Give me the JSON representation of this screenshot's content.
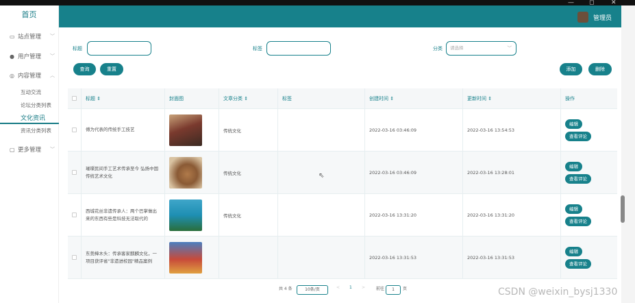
{
  "window": {
    "min": "—",
    "max": "◻",
    "close": "✕"
  },
  "sidebar": {
    "home": "首页",
    "items": [
      {
        "label": "站点管理",
        "icon": "monitor-icon"
      },
      {
        "label": "用户管理",
        "icon": "user-icon"
      },
      {
        "label": "内容管理",
        "icon": "content-icon"
      },
      {
        "label": "更多管理",
        "icon": "more-icon"
      }
    ],
    "subitems": [
      "互动交流",
      "论坛分类列表",
      "文化资讯",
      "资讯分类列表"
    ]
  },
  "header": {
    "admin": "管理员"
  },
  "search": {
    "title_label": "标题",
    "tag_label": "标签",
    "category_label": "分类",
    "category_placeholder": "请选择",
    "query_button": "查询",
    "reset_button": "重置",
    "add_button": "添加",
    "delete_button": "删除"
  },
  "table": {
    "columns": [
      "标题 ⇕",
      "封面图",
      "文章分类 ⇕",
      "标签",
      "创建时间 ⇕",
      "更新时间 ⇕",
      "操作"
    ],
    "rows": [
      {
        "title": "傅为代表的传统手工技艺",
        "category": "传统文化",
        "tag": "",
        "created": "2022-03-16 03:46:09",
        "updated": "2022-03-16 13:54:53"
      },
      {
        "title": "璀璨民间手工艺术传承至今 弘扬中国传统艺术文化",
        "category": "传统文化",
        "tag": "",
        "created": "2022-03-16 03:46:09",
        "updated": "2022-03-16 13:28:01"
      },
      {
        "title": "西城花丝非遗传承人：两个巴掌做出来的东西有些是科技无法取代的",
        "category": "传统文化",
        "tag": "",
        "created": "2022-03-16 13:31:20",
        "updated": "2022-03-16 13:31:20"
      },
      {
        "title": "东莞樟木头：传承客家麒麟文化，一项目获评省\"非遗进校园\"精品案例",
        "category": "",
        "tag": "",
        "created": "2022-03-16 13:31:53",
        "updated": "2022-03-16 13:31:53"
      }
    ],
    "edit_button": "编辑",
    "comment_button": "查看评论"
  },
  "pagination": {
    "total": "共 4 条",
    "page_size": "10条/页",
    "prev": "<",
    "current": "1",
    "next": ">",
    "goto_label": "前往",
    "goto_value": "1",
    "page_unit": "页"
  },
  "watermark": "CSDN @weixin_bysj1330",
  "colors": {
    "accent": "#17818b"
  }
}
